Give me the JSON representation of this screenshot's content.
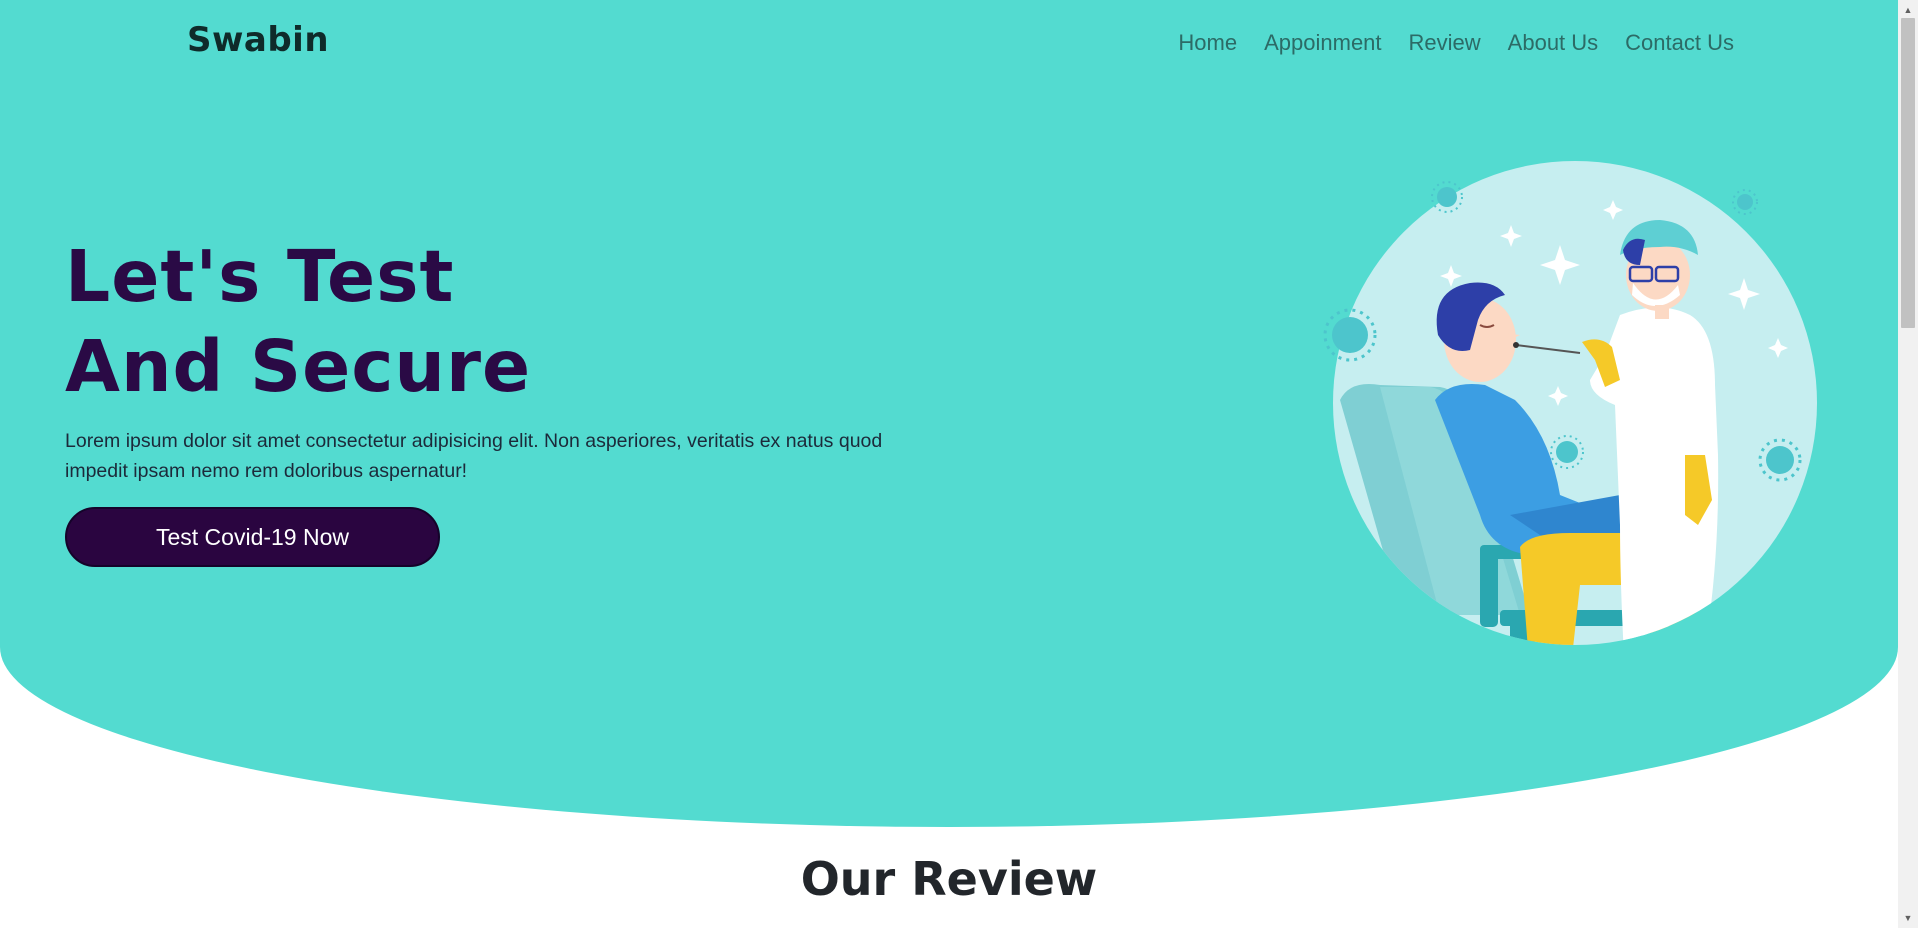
{
  "header": {
    "brand": "Swabin",
    "nav": [
      "Home",
      "Appoinment",
      "Review",
      "About Us",
      "Contact Us"
    ]
  },
  "hero": {
    "headline_line1": "Let's Test",
    "headline_line2": "And Secure",
    "description": "Lorem ipsum dolor sit amet consectetur adipisicing elit. Non asperiores, veritatis ex natus quod impedit ipsam nemo rem doloribus aspernatur!",
    "cta_label": "Test Covid-19 Now",
    "illustration": "covid-swab-test-illustration"
  },
  "reviews": {
    "title": "Our Review"
  },
  "colors": {
    "hero_bg": "#53dbd0",
    "headline": "#2a0a45",
    "cta_bg": "#2a0540"
  }
}
